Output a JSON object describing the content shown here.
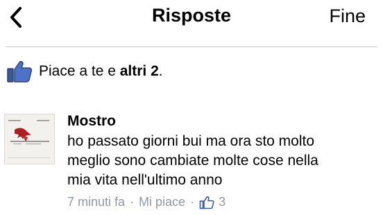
{
  "navbar": {
    "title": "Risposte",
    "done_label": "Fine",
    "back_icon": "chevron-left-icon"
  },
  "likes": {
    "icon": "thumbs-up-icon",
    "prefix": "Piace a te e ",
    "bold": "altri 2",
    "suffix": "."
  },
  "comment": {
    "author": "Mostro",
    "text": "ho passato giorni bui ma ora sto molto\nmeglio sono cambiate molte cose nella\nmia vita nell'ultimo anno",
    "time": "7 minuti fa",
    "separator": "·",
    "like_label": "Mi piace",
    "like_count": "3",
    "like_icon": "thumbs-up-icon"
  },
  "colors": {
    "accent_blue": "#3b5998",
    "meta_gray": "#9197a3",
    "divider": "#c8c7cc"
  }
}
